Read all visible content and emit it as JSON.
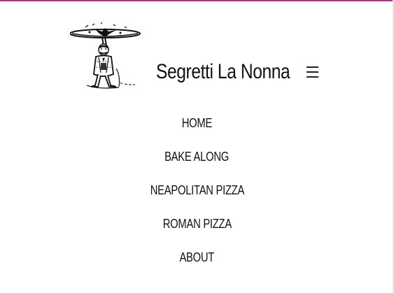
{
  "site": {
    "title": "Segretti La Nonna",
    "accent_color": "#a23e84",
    "logo_icon": "pizza-chef-icon",
    "menu_icon": "hamburger-menu-icon"
  },
  "nav": {
    "items": [
      {
        "label": "HOME"
      },
      {
        "label": "BAKE ALONG"
      },
      {
        "label": "NEAPOLITAN PIZZA"
      },
      {
        "label": "ROMAN PIZZA"
      },
      {
        "label": "ABOUT"
      }
    ]
  }
}
